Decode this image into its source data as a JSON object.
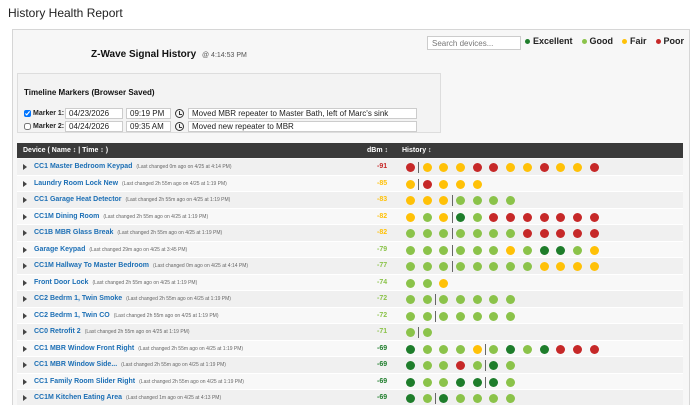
{
  "page_title": "History Health Report",
  "report": {
    "title": "Z-Wave Signal History",
    "time": "@ 4:14:53 PM"
  },
  "search": {
    "placeholder": "Search devices..."
  },
  "legend": [
    {
      "label": "Excellent",
      "color": "#1e7d2b"
    },
    {
      "label": "Good",
      "color": "#8bc34a"
    },
    {
      "label": "Fair",
      "color": "#ffc107"
    },
    {
      "label": "Poor",
      "color": "#c62828"
    }
  ],
  "colors": {
    "excellent": "#1e7d2b",
    "good": "#8bc34a",
    "fair": "#ffc107",
    "poor": "#c62828",
    "link": "#1c6fb5"
  },
  "markers": {
    "title": "Timeline Markers (Browser Saved)",
    "items": [
      {
        "checked": true,
        "label": "Marker 1:",
        "date": "04/23/2026",
        "time": "09:19 PM",
        "note": "Moved MBR repeater to Master Bath, left of Marc's sink"
      },
      {
        "checked": false,
        "label": "Marker 2:",
        "date": "04/24/2026",
        "time": "09:35 AM",
        "note": "Moved new repeater to MBR"
      }
    ]
  },
  "table": {
    "col_device": "Device ( Name ↕ | Time ↕ )",
    "col_dbm": "dBm ↕",
    "col_history": "History ↕",
    "rows": [
      {
        "name": "CC1 Master Bedroom Keypad",
        "note": "(Last changed 0m ago on 4/25 at 4:14 PM)",
        "dbm": "-91",
        "dbm_level": "poor",
        "history": [
          "poor",
          "fair",
          "fair",
          "fair",
          "poor",
          "poor",
          "fair",
          "fair",
          "poor",
          "fair",
          "fair",
          "poor"
        ],
        "marker_after": 1
      },
      {
        "name": "Laundry Room Lock New",
        "note": "(Last changed 2h 55m ago on 4/25 at 1:19 PM)",
        "dbm": "-85",
        "dbm_level": "fair",
        "history": [
          "fair",
          "poor",
          "fair",
          "fair",
          "fair"
        ],
        "marker_after": 1
      },
      {
        "name": "CC1 Garage Heat Detector",
        "note": "(Last changed 2h 55m ago on 4/25 at 1:19 PM)",
        "dbm": "-83",
        "dbm_level": "fair",
        "history": [
          "fair",
          "fair",
          "fair",
          "good",
          "good",
          "good",
          "good"
        ],
        "marker_after": 3
      },
      {
        "name": "CC1M Dining Room",
        "note": "(Last changed 2h 55m ago on 4/25 at 1:19 PM)",
        "dbm": "-82",
        "dbm_level": "fair",
        "history": [
          "fair",
          "good",
          "fair",
          "excellent",
          "good",
          "poor",
          "poor",
          "poor",
          "poor",
          "poor",
          "poor",
          "poor"
        ],
        "marker_after": 3
      },
      {
        "name": "CC1B MBR Glass Break",
        "note": "(Last changed 2h 55m ago on 4/25 at 1:19 PM)",
        "dbm": "-82",
        "dbm_level": "fair",
        "history": [
          "good",
          "good",
          "good",
          "good",
          "good",
          "good",
          "good",
          "poor",
          "poor",
          "poor",
          "poor",
          "poor"
        ],
        "marker_after": 3
      },
      {
        "name": "Garage Keypad",
        "note": "(Last changed 29m ago on 4/25 at 3:45 PM)",
        "dbm": "-79",
        "dbm_level": "good",
        "history": [
          "good",
          "good",
          "good",
          "good",
          "good",
          "good",
          "fair",
          "good",
          "excellent",
          "excellent",
          "good",
          "fair"
        ],
        "marker_after": 3
      },
      {
        "name": "CC1M Hallway To Master Bedroom",
        "note": "(Last changed 0m ago on 4/25 at 4:14 PM)",
        "dbm": "-77",
        "dbm_level": "good",
        "history": [
          "good",
          "good",
          "good",
          "good",
          "good",
          "good",
          "good",
          "good",
          "fair",
          "fair",
          "fair",
          "fair"
        ],
        "marker_after": 3
      },
      {
        "name": "Front Door Lock",
        "note": "(Last changed 2h 55m ago on 4/25 at 1:19 PM)",
        "dbm": "-74",
        "dbm_level": "good",
        "history": [
          "good",
          "good",
          "fair"
        ],
        "marker_after": 0
      },
      {
        "name": "CC2 Bedrm 1, Twin Smoke",
        "note": "(Last changed 2h 55m ago on 4/25 at 1:19 PM)",
        "dbm": "-72",
        "dbm_level": "good",
        "history": [
          "good",
          "good",
          "good",
          "good",
          "good",
          "good",
          "good"
        ],
        "marker_after": 2
      },
      {
        "name": "CC2 Bedrm 1, Twin CO",
        "note": "(Last changed 2h 55m ago on 4/25 at 1:19 PM)",
        "dbm": "-72",
        "dbm_level": "good",
        "history": [
          "good",
          "good",
          "good",
          "good",
          "good",
          "good",
          "good"
        ],
        "marker_after": 2
      },
      {
        "name": "CC0 Retrofit 2",
        "note": "(Last changed 2h 55m ago on 4/25 at 1:19 PM)",
        "dbm": "-71",
        "dbm_level": "good",
        "history": [
          "good",
          "good"
        ],
        "marker_after": 1
      },
      {
        "name": "CC1 MBR Window Front Right",
        "note": "(Last changed 2h 55m ago on 4/25 at 1:19 PM)",
        "dbm": "-69",
        "dbm_level": "excellent",
        "history": [
          "excellent",
          "good",
          "good",
          "good",
          "fair",
          "good",
          "excellent",
          "good",
          "excellent",
          "poor",
          "poor",
          "poor"
        ],
        "marker_after": 5
      },
      {
        "name": "CC1 MBR Window Side...",
        "note": "(Last changed 2h 55m ago on 4/25 at 1:19 PM)",
        "dbm": "-69",
        "dbm_level": "excellent",
        "history": [
          "excellent",
          "good",
          "good",
          "poor",
          "good",
          "excellent",
          "good"
        ],
        "marker_after": 5
      },
      {
        "name": "CC1 Family Room Slider Right",
        "note": "(Last changed 2h 55m ago on 4/25 at 1:19 PM)",
        "dbm": "-69",
        "dbm_level": "excellent",
        "history": [
          "excellent",
          "good",
          "good",
          "excellent",
          "excellent",
          "excellent",
          "good"
        ],
        "marker_after": 5
      },
      {
        "name": "CC1M Kitchen Eating Area",
        "note": "(Last changed 1m ago on 4/25 at 4:13 PM)",
        "dbm": "-69",
        "dbm_level": "excellent",
        "history": [
          "excellent",
          "good",
          "excellent",
          "good",
          "good",
          "good",
          "good"
        ],
        "marker_after": 2
      }
    ]
  }
}
